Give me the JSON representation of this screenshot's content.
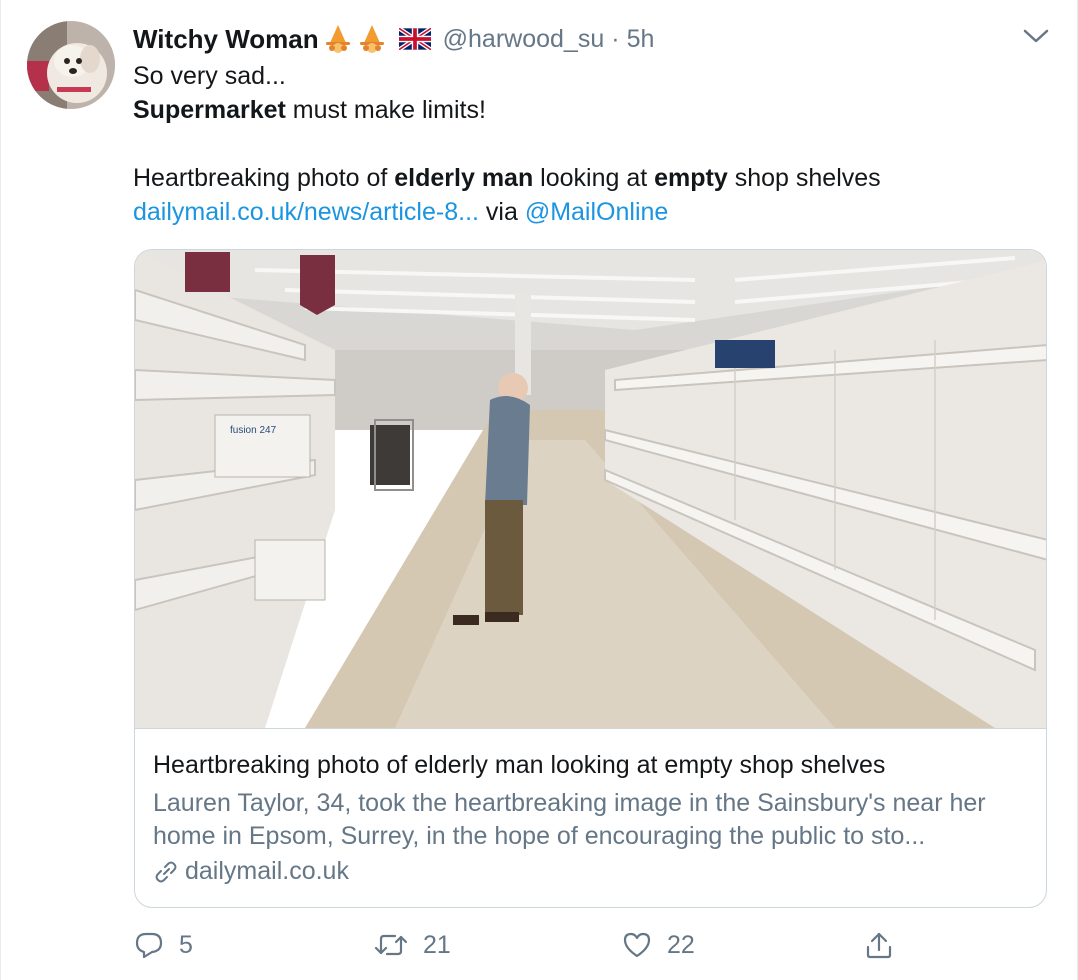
{
  "user": {
    "display_name": "Witchy Woman",
    "handle": "@harwood_su",
    "separator": "·",
    "time": "5h"
  },
  "tweet": {
    "line1": "So very sad...",
    "line2_bold": "Supermarket",
    "line2_rest": " must make limits!",
    "line3_a": "Heartbreaking photo of ",
    "line3_b": "elderly man",
    "line3_c": " looking at ",
    "line3_d": "empty",
    "line3_e": " shop shelves",
    "link_text": "dailymail.co.uk/news/article-8...",
    "via_text": " via ",
    "mention": "@MailOnline"
  },
  "card": {
    "title": "Heartbreaking photo of elderly man looking at empty shop shelves",
    "description": "Lauren Taylor, 34, took the heartbreaking image in the Sainsbury's near her home in Epsom, Surrey, in the hope of encouraging the public to sto...",
    "domain": "dailymail.co.uk",
    "photo_box_label": "fusion 247"
  },
  "actions": {
    "replies": "5",
    "retweets": "21",
    "likes": "22"
  },
  "icons": [
    "caret-down-icon",
    "reply-icon",
    "retweet-icon",
    "like-icon",
    "share-icon",
    "link-icon",
    "flag-uk-icon",
    "witch-emoji-icon"
  ],
  "colors": {
    "link": "#1b95e0",
    "muted": "#657786",
    "text": "#14171a",
    "border": "#ccd6dd"
  }
}
